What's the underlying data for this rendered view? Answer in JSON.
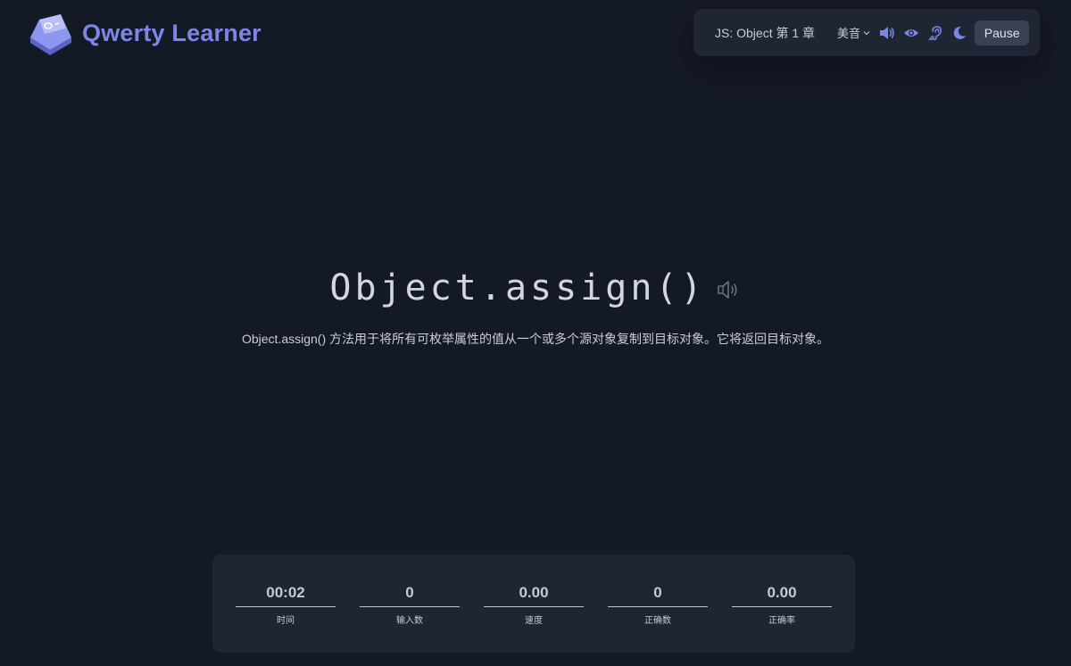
{
  "app": {
    "name": "Qwerty Learner",
    "brand_color": "#7c86e6",
    "logo_icon": "keycap-logo-icon"
  },
  "toolbar": {
    "dictionary_chapter": "JS: Object 第 1 章",
    "accent": "美音",
    "icons": [
      "speaker-icon",
      "eye-icon",
      "hearing-icon",
      "moon-icon"
    ],
    "pause_label": "Pause"
  },
  "word": {
    "text": "Object.assign()",
    "translation": "Object.assign() 方法用于将所有可枚举属性的值从一个或多个源对象复制到目标对象。它将返回目标对象。",
    "speaker_icon": "speaker-icon"
  },
  "stats": [
    {
      "value": "00:02",
      "label": "时间"
    },
    {
      "value": "0",
      "label": "输入数"
    },
    {
      "value": "0.00",
      "label": "速度"
    },
    {
      "value": "0",
      "label": "正确数"
    },
    {
      "value": "0.00",
      "label": "正确率"
    }
  ]
}
